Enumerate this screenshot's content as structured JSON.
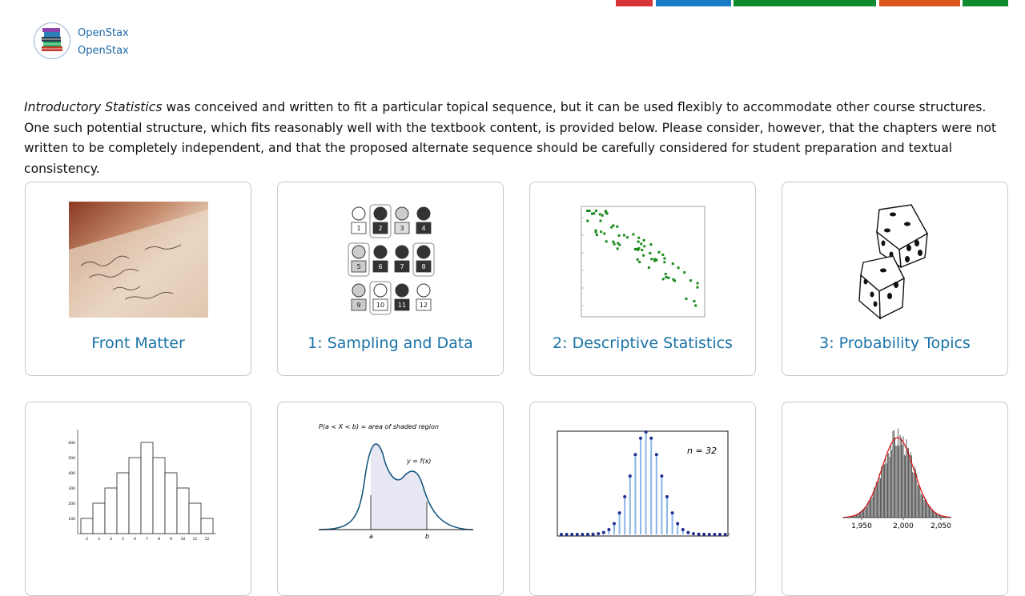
{
  "site": {
    "topbar_colors": [
      "#d9343a",
      "#1a7bc6",
      "#0e8a2f",
      "#d9561c",
      "#0e8a2f"
    ]
  },
  "library": {
    "line1": "OpenStax",
    "line2": "OpenStax",
    "logo_icon": "books-icon"
  },
  "intro": {
    "book_title": "Introductory Statistics",
    "text": " was conceived and written to fit a particular topical sequence, but it can be used flexibly to accommodate other course structures. One such potential structure, which fits reasonably well with the textbook content, is provided below. Please consider, however, that the chapters were not written to be completely independent, and that the proposed alternate sequence should be carefully considered for student preparation and textual consistency."
  },
  "cards": [
    {
      "title": "Front Matter",
      "image": "handwritten-paper-image"
    },
    {
      "title": "1: Sampling and Data",
      "image": "sampling-grid-image",
      "numbers": [
        "1",
        "2",
        "3",
        "4",
        "5",
        "6",
        "7",
        "8",
        "9",
        "10",
        "11",
        "12"
      ]
    },
    {
      "title": "2: Descriptive Statistics",
      "image": "scatter-plot-image"
    },
    {
      "title": "3: Probability Topics",
      "image": "dice-image"
    },
    {
      "title": "",
      "image": "histogram-image",
      "ticks_y": [
        "600",
        "500",
        "400",
        "300",
        "200",
        "100"
      ],
      "ticks_x": [
        "2",
        "3",
        "4",
        "5",
        "6",
        "7",
        "8",
        "9",
        "10",
        "11",
        "12"
      ]
    },
    {
      "title": "",
      "image": "density-curve-image",
      "caption": "P(a < X < b) = area of shaded region",
      "fn": "y = f(x)",
      "a": "a",
      "b": "b"
    },
    {
      "title": "",
      "image": "binomial-stem-image",
      "n_label": "n = 32"
    },
    {
      "title": "",
      "image": "normal-histogram-image",
      "ticks_x": [
        "1,950",
        "2,000",
        "2,050"
      ]
    }
  ]
}
